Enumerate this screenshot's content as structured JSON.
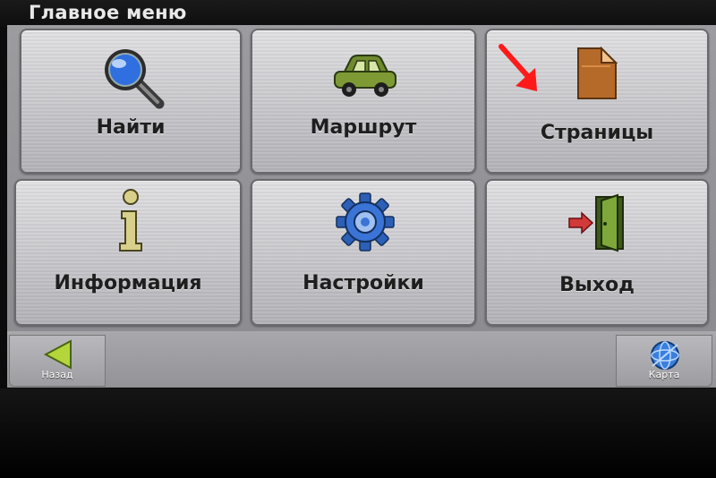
{
  "header": {
    "title": "Главное меню"
  },
  "menu": {
    "items": [
      {
        "label": "Найти",
        "icon": "magnifier-icon"
      },
      {
        "label": "Маршрут",
        "icon": "car-icon"
      },
      {
        "label": "Страницы",
        "icon": "page-icon"
      },
      {
        "label": "Информация",
        "icon": "info-icon"
      },
      {
        "label": "Настройки",
        "icon": "gear-icon"
      },
      {
        "label": "Выход",
        "icon": "exit-door-icon"
      }
    ]
  },
  "navbar": {
    "back_label": "Назад",
    "map_label": "Карта"
  },
  "annotation": {
    "arrow_color": "#ff1a1a"
  }
}
